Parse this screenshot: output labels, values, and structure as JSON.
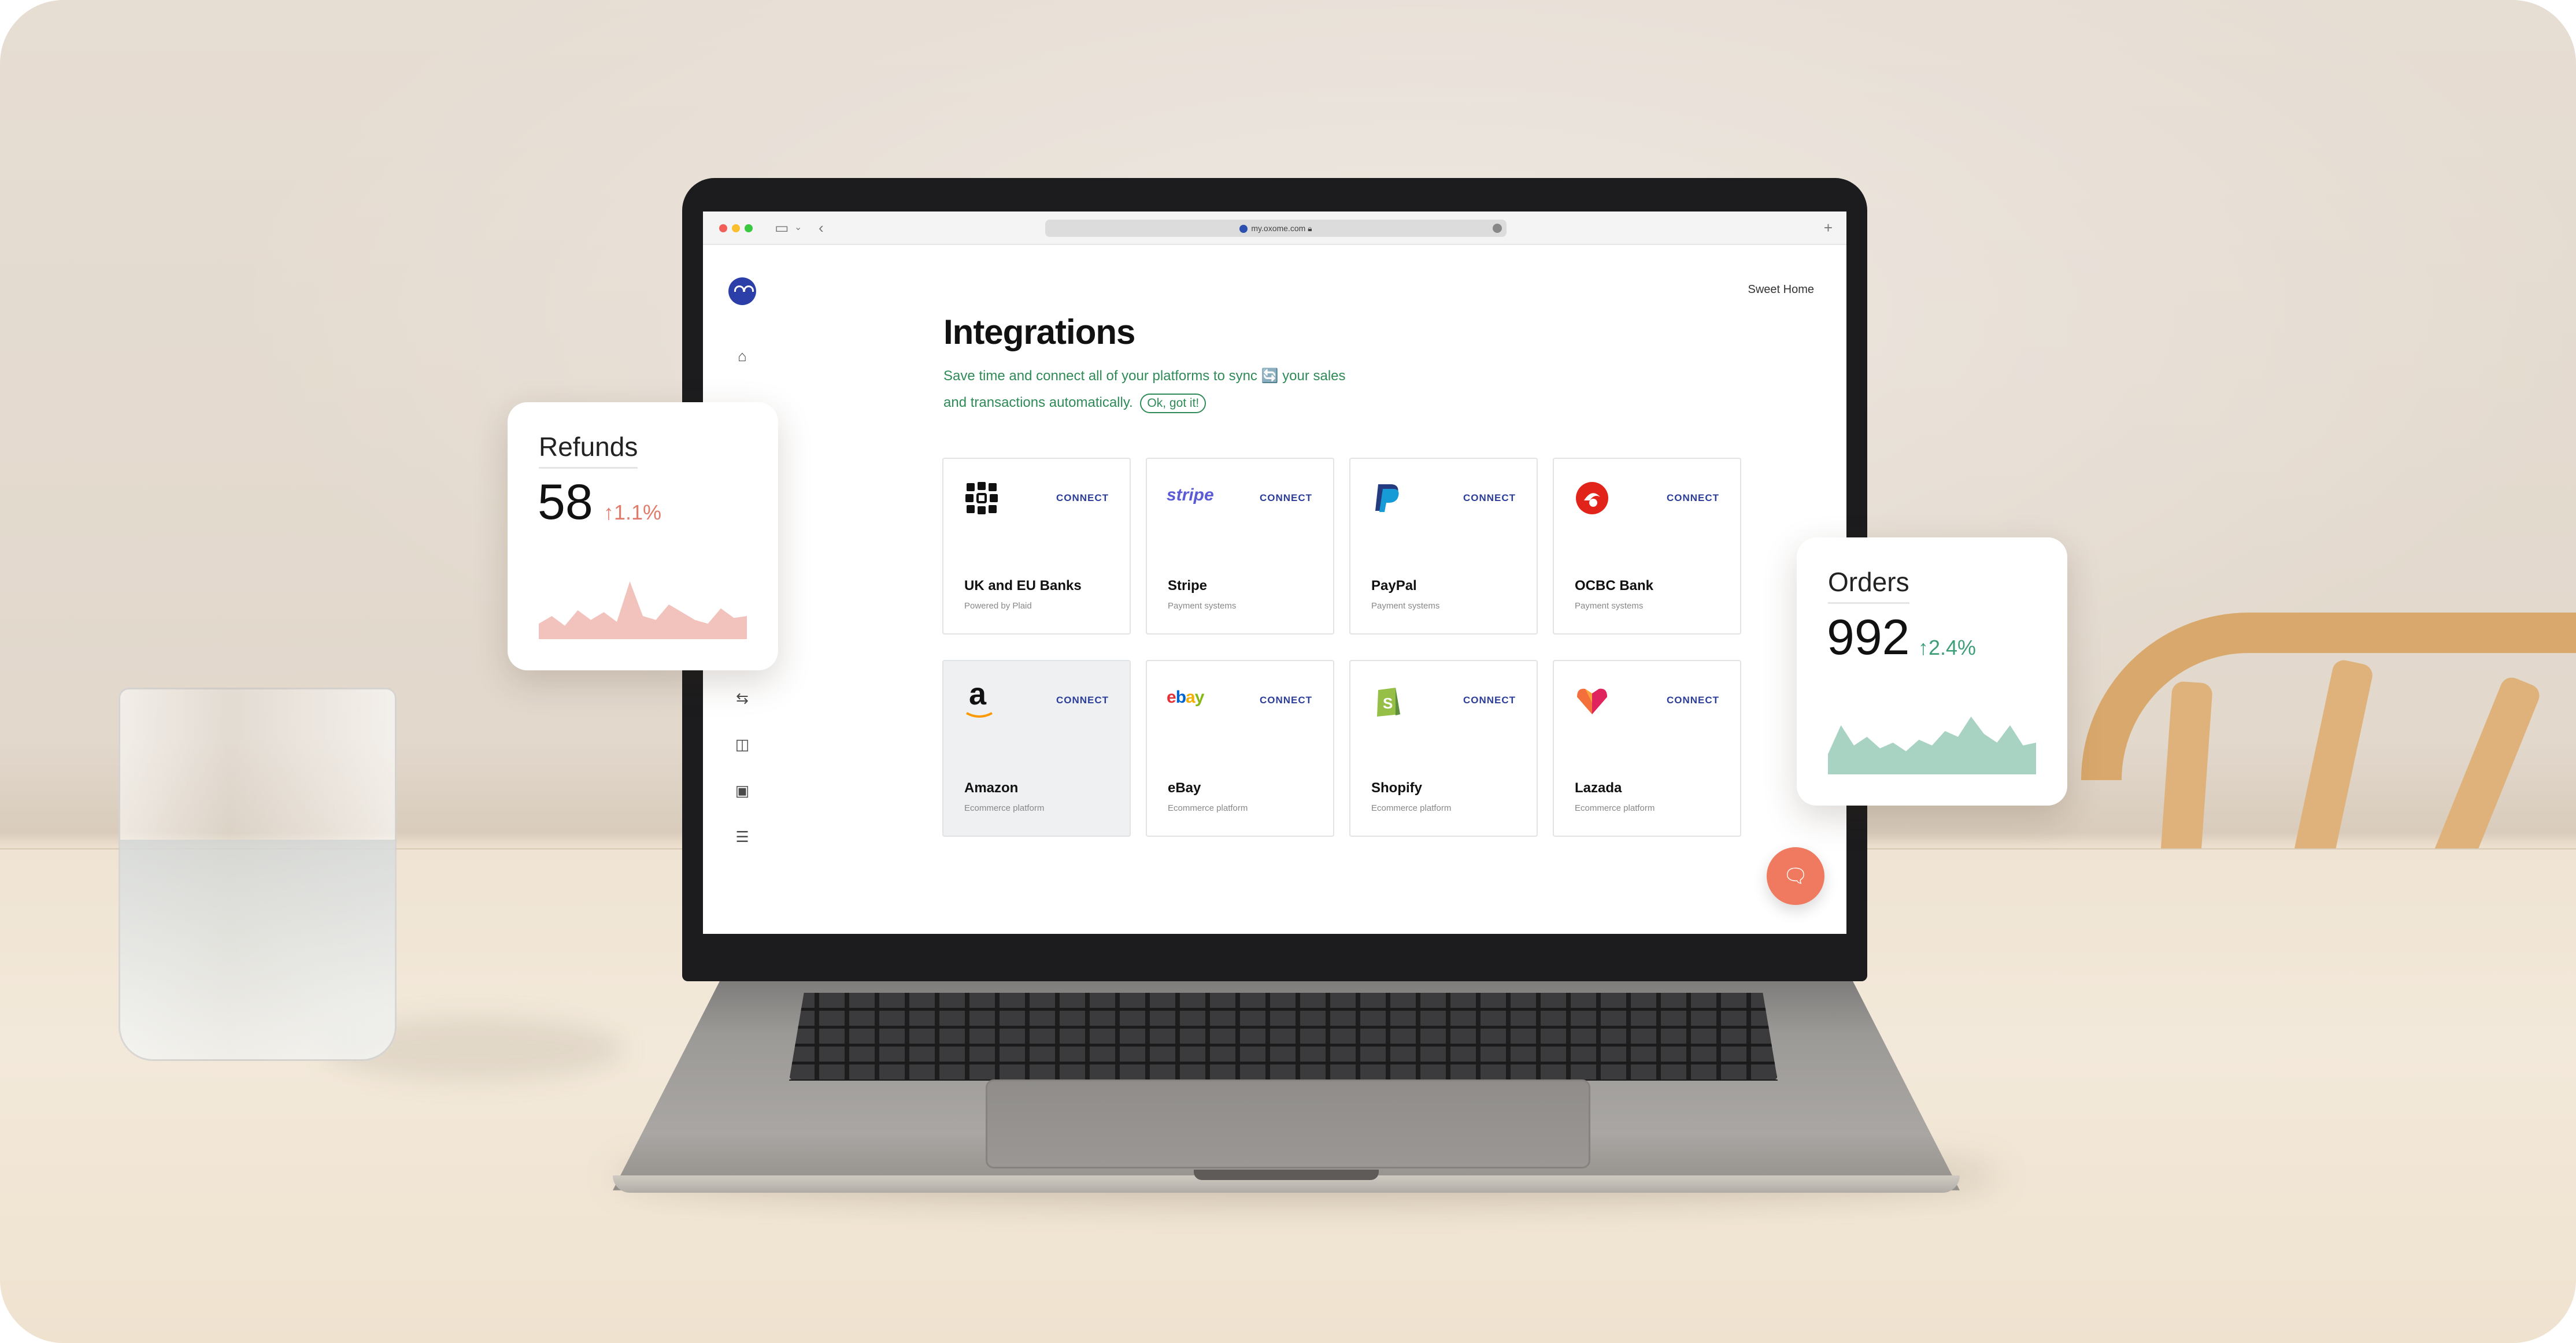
{
  "browser": {
    "url": "my.oxome.com",
    "lock_icon": "lock-icon"
  },
  "app": {
    "workspace_name": "Sweet Home",
    "page_title": "Integrations",
    "intro_line1": "Save time and connect all of your platforms to sync 🔄 your sales",
    "intro_line2": "and transactions automatically.",
    "dismiss_label": "Ok, got it!",
    "sidebar_icons": [
      "home-icon",
      "transfer-icon",
      "chart-icon",
      "wallet-icon",
      "settings-sliders-icon"
    ],
    "colors": {
      "accent_green": "#2e8b57",
      "connect_blue": "#2b3d9a",
      "fab_orange": "#ef7a5f"
    }
  },
  "integrations": [
    {
      "name": "UK and EU Banks",
      "description": "Powered by Plaid",
      "action": "CONNECT",
      "icon": "plaid-icon"
    },
    {
      "name": "Stripe",
      "description": "Payment systems",
      "action": "CONNECT",
      "icon": "stripe-icon",
      "logo_text": "stripe"
    },
    {
      "name": "PayPal",
      "description": "Payment systems",
      "action": "CONNECT",
      "icon": "paypal-icon"
    },
    {
      "name": "OCBC Bank",
      "description": "Payment systems",
      "action": "CONNECT",
      "icon": "ocbc-icon"
    },
    {
      "name": "Amazon",
      "description": "Ecommerce platform",
      "action": "CONNECT",
      "icon": "amazon-icon",
      "logo_text": "a"
    },
    {
      "name": "eBay",
      "description": "Ecommerce platform",
      "action": "CONNECT",
      "icon": "ebay-icon",
      "logo_text": "ebay"
    },
    {
      "name": "Shopify",
      "description": "Ecommerce platform",
      "action": "CONNECT",
      "icon": "shopify-icon",
      "logo_text": "S"
    },
    {
      "name": "Lazada",
      "description": "Ecommerce platform",
      "action": "CONNECT",
      "icon": "lazada-icon"
    }
  ],
  "refunds_card": {
    "title": "Refunds",
    "value": "58",
    "change": "1.1%",
    "trend": "up",
    "color": "#e07b6a",
    "sparkline": [
      8,
      12,
      7,
      15,
      10,
      14,
      9,
      30,
      12,
      10,
      18,
      14,
      10,
      8,
      16,
      11,
      12
    ]
  },
  "orders_card": {
    "title": "Orders",
    "value": "992",
    "change": "2.4%",
    "trend": "up",
    "color": "#3e9e78",
    "sparkline": [
      14,
      34,
      20,
      26,
      18,
      22,
      16,
      24,
      20,
      30,
      26,
      40,
      28,
      22,
      34,
      20,
      22
    ]
  }
}
